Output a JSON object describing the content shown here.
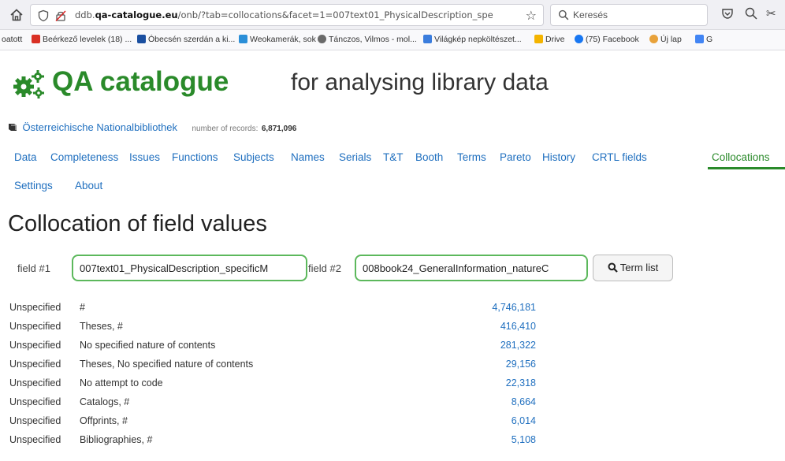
{
  "browser": {
    "url_prefix": "ddb.",
    "url_domain": "qa-catalogue.eu",
    "url_rest": "/onb/?tab=collocations&facet=1=007text01_PhysicalDescription_spe",
    "search_placeholder": "Keresés",
    "bookmarks": [
      {
        "label": "oatott",
        "color": "#f9f9fb"
      },
      {
        "label": "Beérkező levelek (18) ...",
        "color": "#d93025"
      },
      {
        "label": "Óbecsén szerdán a ki...",
        "color": "#1a4fa0"
      },
      {
        "label": "Weokamerák, sok",
        "color": "#2b8fd8"
      },
      {
        "label": "Tánczos, Vilmos - mol...",
        "color": "#6a6a6a"
      },
      {
        "label": "Világkép nepköltészet...",
        "color": "#3b7ddd"
      },
      {
        "label": "Drive",
        "color": "#f4b400"
      },
      {
        "label": "(75) Facebook",
        "color": "#1877f2"
      },
      {
        "label": "Új lap",
        "color": "#e8a23b"
      },
      {
        "label": "G",
        "color": "#4285f4"
      }
    ]
  },
  "app": {
    "title": "QA catalogue",
    "subtitle": "for analysing library data",
    "library_name": "Österreichische Nationalbibliothek",
    "records_label": "number of records:",
    "records_value": "6,871,096",
    "brand_color": "#2a8a2a",
    "link_color": "#1f6fbf"
  },
  "nav": {
    "items": [
      "Data",
      "Completeness",
      "Issues",
      "Functions",
      "Subjects",
      "Names",
      "Serials",
      "T&T",
      "Booth",
      "Terms",
      "Pareto",
      "History",
      "CRTL fields",
      "Collocations"
    ],
    "items_row2": [
      "Settings",
      "About"
    ],
    "active": "Collocations"
  },
  "page": {
    "title": "Collocation of field values"
  },
  "form": {
    "field1_label": "field #1",
    "field1_value": "007text01_PhysicalDescription_specificM",
    "field2_label": "field #2",
    "field2_value": "008book24_GeneralInformation_natureC",
    "button_label": "Term list"
  },
  "results": [
    {
      "field1": "Unspecified",
      "field2": "#",
      "count": "4,746,181"
    },
    {
      "field1": "Unspecified",
      "field2": "Theses, #",
      "count": "416,410"
    },
    {
      "field1": "Unspecified",
      "field2": "No specified nature of contents",
      "count": "281,322"
    },
    {
      "field1": "Unspecified",
      "field2": "Theses, No specified nature of contents",
      "count": "29,156"
    },
    {
      "field1": "Unspecified",
      "field2": "No attempt to code",
      "count": "22,318"
    },
    {
      "field1": "Unspecified",
      "field2": "Catalogs, #",
      "count": "8,664"
    },
    {
      "field1": "Unspecified",
      "field2": "Offprints, #",
      "count": "6,014"
    },
    {
      "field1": "Unspecified",
      "field2": "Bibliographies, #",
      "count": "5,108"
    }
  ]
}
